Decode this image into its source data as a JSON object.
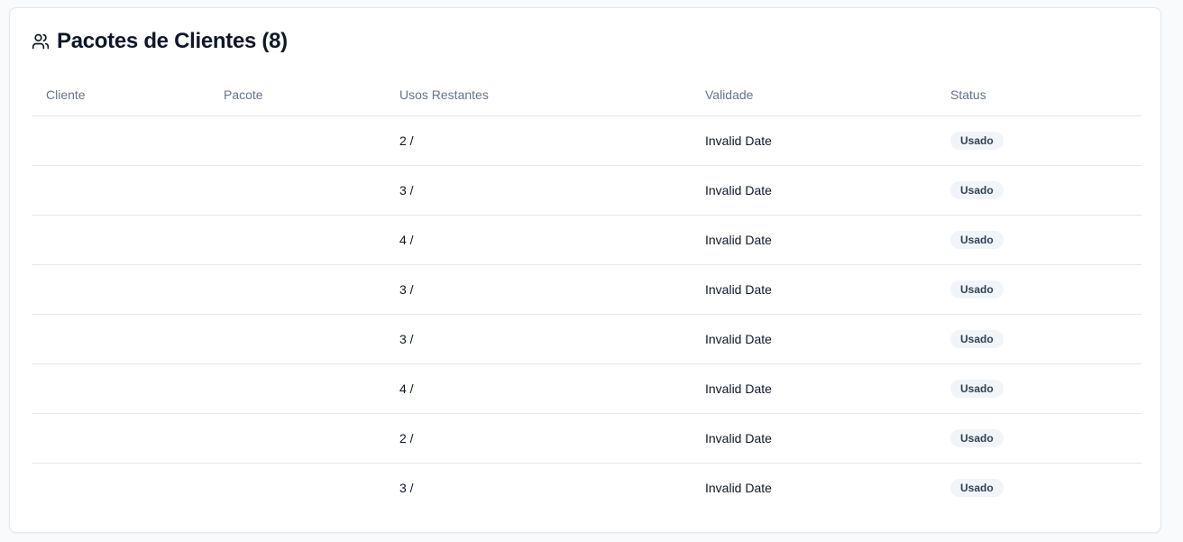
{
  "card": {
    "title": "Pacotes de Clientes (8)",
    "icon": "users-icon"
  },
  "table": {
    "columns": [
      "Cliente",
      "Pacote",
      "Usos Restantes",
      "Validade",
      "Status"
    ],
    "rows": [
      {
        "cliente": "",
        "pacote": "",
        "usos": "2 /",
        "validade": "Invalid Date",
        "status": "Usado"
      },
      {
        "cliente": "",
        "pacote": "",
        "usos": "3 /",
        "validade": "Invalid Date",
        "status": "Usado"
      },
      {
        "cliente": "",
        "pacote": "",
        "usos": "4 /",
        "validade": "Invalid Date",
        "status": "Usado"
      },
      {
        "cliente": "",
        "pacote": "",
        "usos": "3 /",
        "validade": "Invalid Date",
        "status": "Usado"
      },
      {
        "cliente": "",
        "pacote": "",
        "usos": "3 /",
        "validade": "Invalid Date",
        "status": "Usado"
      },
      {
        "cliente": "",
        "pacote": "",
        "usos": "4 /",
        "validade": "Invalid Date",
        "status": "Usado"
      },
      {
        "cliente": "",
        "pacote": "",
        "usos": "2 /",
        "validade": "Invalid Date",
        "status": "Usado"
      },
      {
        "cliente": "",
        "pacote": "",
        "usos": "3 /",
        "validade": "Invalid Date",
        "status": "Usado"
      }
    ]
  },
  "colors": {
    "border": "#e2e8f0",
    "header_text": "#64748b",
    "badge_bg": "#f1f5f9"
  }
}
